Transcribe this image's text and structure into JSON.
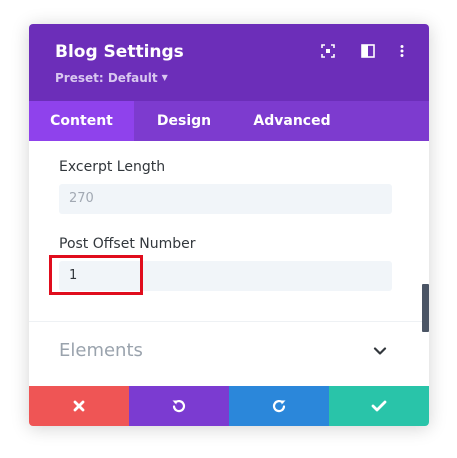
{
  "header": {
    "title": "Blog Settings",
    "preset": "Preset: Default",
    "colors": {
      "header_bg": "#6c2eb9",
      "tabs_bg": "#7d3bcf",
      "active_tab_bg": "#8f42ec"
    },
    "icons": [
      "expand-icon",
      "sidebar-toggle-icon",
      "more-options-icon"
    ]
  },
  "tabs": [
    {
      "label": "Content",
      "active": true
    },
    {
      "label": "Design",
      "active": false
    },
    {
      "label": "Advanced",
      "active": false
    }
  ],
  "fields": {
    "excerpt_length": {
      "label": "Excerpt Length",
      "placeholder": "270",
      "value": ""
    },
    "post_offset": {
      "label": "Post Offset Number",
      "value": "1"
    }
  },
  "sections": {
    "elements": {
      "label": "Elements",
      "expanded": false
    }
  },
  "footer": {
    "buttons": [
      {
        "name": "cancel",
        "icon": "close-icon",
        "color": "#ef5555"
      },
      {
        "name": "undo",
        "icon": "undo-icon",
        "color": "#7b3bd1"
      },
      {
        "name": "redo",
        "icon": "redo-icon",
        "color": "#2b87da"
      },
      {
        "name": "save",
        "icon": "check-icon",
        "color": "#29c4a9"
      }
    ]
  }
}
